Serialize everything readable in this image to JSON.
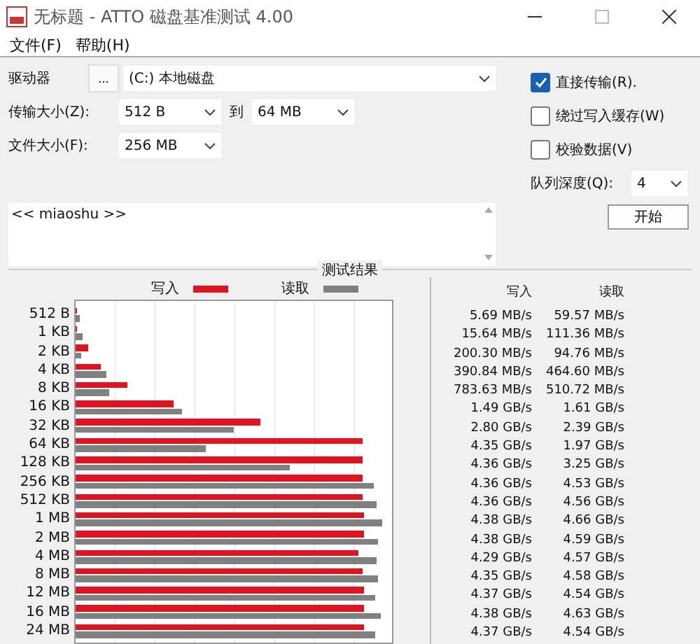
{
  "window": {
    "title": "无标题 - ATTO 磁盘基准测试 4.00"
  },
  "menu": [
    "文件(F)",
    "帮助(H)"
  ],
  "form": {
    "drive_label": "驱动器",
    "browse_button": "...",
    "drive_value": "(C:) 本地磁盘",
    "transfer_label": "传输大小(Z):",
    "transfer_from": "512 B",
    "transfer_to_label": "到",
    "transfer_to": "64 MB",
    "file_size_label": "文件大小(F):",
    "file_size": "256 MB",
    "description": "<< miaoshu >>"
  },
  "options": [
    {
      "label": "直接传输(R).",
      "checked": true
    },
    {
      "label": "绕过写入缓存(W)",
      "checked": false
    },
    {
      "label": "校验数据(V)",
      "checked": false
    }
  ],
  "queue": {
    "label": "队列深度(Q):",
    "value": "4"
  },
  "start_button": "开始",
  "results": {
    "title": "测试结果",
    "write_legend": "写入",
    "read_legend": "读取",
    "write_header": "写入",
    "read_header": "读取",
    "rows": [
      {
        "size": "512 B",
        "write": {
          "value": "5.69 MB/s",
          "level": 0.0012
        },
        "read": {
          "value": "59.57 MB/s",
          "level": 0.0124
        }
      },
      {
        "size": "1 KB",
        "write": {
          "value": "15.64 MB/s",
          "level": 0.0033
        },
        "read": {
          "value": "111.36 MB/s",
          "level": 0.0232
        }
      },
      {
        "size": "2 KB",
        "write": {
          "value": "200.30 MB/s",
          "level": 0.0417
        },
        "read": {
          "value": "94.76 MB/s",
          "level": 0.0197
        }
      },
      {
        "size": "4 KB",
        "write": {
          "value": "390.84 MB/s",
          "level": 0.0814
        },
        "read": {
          "value": "464.60 MB/s",
          "level": 0.0968
        }
      },
      {
        "size": "8 KB",
        "write": {
          "value": "783.63 MB/s",
          "level": 0.1633
        },
        "read": {
          "value": "510.72 MB/s",
          "level": 0.1064
        }
      },
      {
        "size": "16 KB",
        "write": {
          "value": "1.49 GB/s",
          "level": 0.3104
        },
        "read": {
          "value": "1.61 GB/s",
          "level": 0.3354
        }
      },
      {
        "size": "32 KB",
        "write": {
          "value": "2.80 GB/s",
          "level": 0.5833
        },
        "read": {
          "value": "2.39 GB/s",
          "level": 0.4979
        }
      },
      {
        "size": "64 KB",
        "write": {
          "value": "4.35 GB/s",
          "level": 0.9063
        },
        "read": {
          "value": "1.97 GB/s",
          "level": 0.4104
        }
      },
      {
        "size": "128 KB",
        "write": {
          "value": "4.36 GB/s",
          "level": 0.9083
        },
        "read": {
          "value": "3.25 GB/s",
          "level": 0.6771
        }
      },
      {
        "size": "256 KB",
        "write": {
          "value": "4.36 GB/s",
          "level": 0.9083
        },
        "read": {
          "value": "4.53 GB/s",
          "level": 0.9438
        }
      },
      {
        "size": "512 KB",
        "write": {
          "value": "4.36 GB/s",
          "level": 0.9083
        },
        "read": {
          "value": "4.56 GB/s",
          "level": 0.95
        }
      },
      {
        "size": "1 MB",
        "write": {
          "value": "4.38 GB/s",
          "level": 0.9125
        },
        "read": {
          "value": "4.66 GB/s",
          "level": 0.9708
        }
      },
      {
        "size": "2 MB",
        "write": {
          "value": "4.38 GB/s",
          "level": 0.9125
        },
        "read": {
          "value": "4.59 GB/s",
          "level": 0.9563
        }
      },
      {
        "size": "4 MB",
        "write": {
          "value": "4.29 GB/s",
          "level": 0.8938
        },
        "read": {
          "value": "4.57 GB/s",
          "level": 0.9521
        }
      },
      {
        "size": "8 MB",
        "write": {
          "value": "4.35 GB/s",
          "level": 0.9063
        },
        "read": {
          "value": "4.58 GB/s",
          "level": 0.9542
        }
      },
      {
        "size": "12 MB",
        "write": {
          "value": "4.37 GB/s",
          "level": 0.9104
        },
        "read": {
          "value": "4.54 GB/s",
          "level": 0.9458
        }
      },
      {
        "size": "16 MB",
        "write": {
          "value": "4.38 GB/s",
          "level": 0.9125
        },
        "read": {
          "value": "4.63 GB/s",
          "level": 0.9646
        }
      },
      {
        "size": "24 MB",
        "write": {
          "value": "4.37 GB/s",
          "level": 0.9104
        },
        "read": {
          "value": "4.54 GB/s",
          "level": 0.9458
        }
      }
    ]
  }
}
